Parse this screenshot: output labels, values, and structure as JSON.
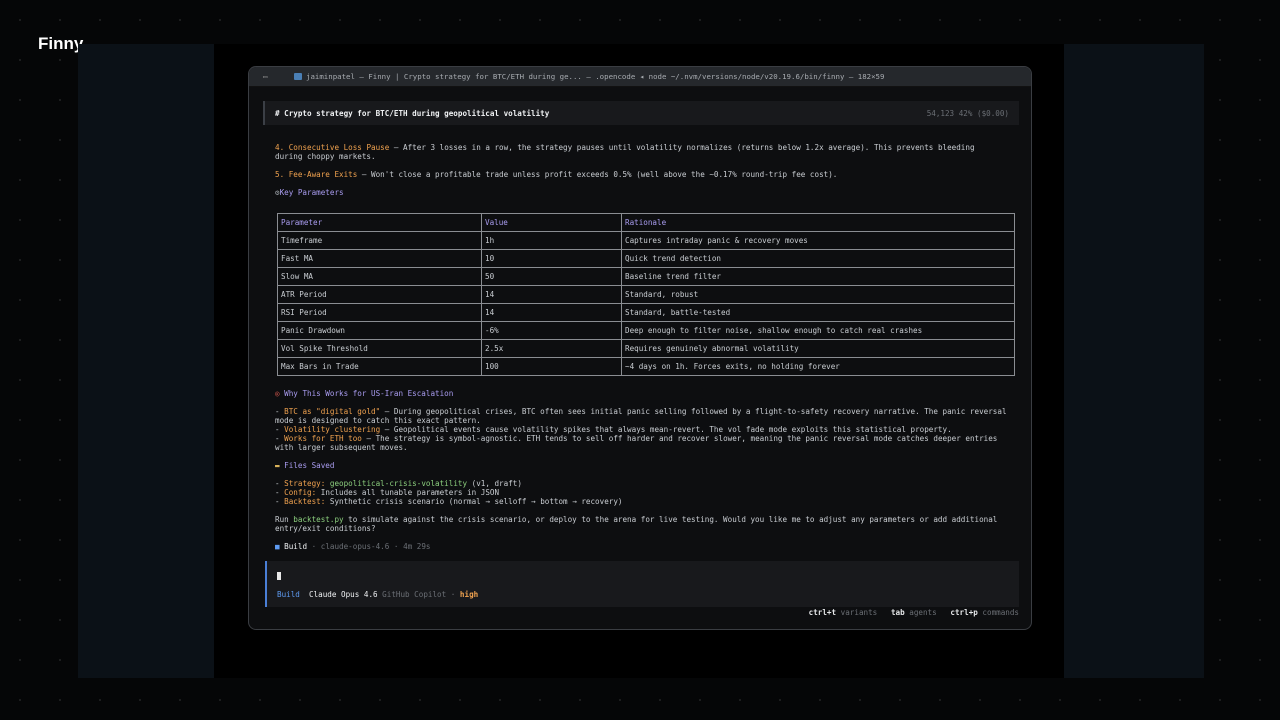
{
  "brand": "Finny",
  "titlebar": "jaiminpatel — Finny | Crypto strategy for BTC/ETH during ge... — .opencode ◂ node ~/.nvm/versions/node/v20.19.6/bin/finny — 182×59",
  "header": {
    "title": "# Crypto strategy for BTC/ETH during geopolitical volatility",
    "stats": "54,123  42% ($0.00)"
  },
  "items": [
    {
      "num": "4.",
      "name": "Consecutive Loss Pause",
      "text": " — After 3 losses in a row, the strategy pauses until volatility normalizes (returns below 1.2x average). This prevents bleeding during choppy markets."
    },
    {
      "num": "5.",
      "name": "Fee-Aware Exits",
      "text": " — Won't close a profitable trade unless profit exceeds 0.5% (well above the ~0.17% round-trip fee cost)."
    }
  ],
  "key_params_heading": "Key Parameters",
  "table": {
    "headers": [
      "Parameter",
      "Value",
      "Rationale"
    ],
    "rows": [
      [
        "Timeframe",
        "1h",
        "Captures intraday panic & recovery moves"
      ],
      [
        "Fast MA",
        "10",
        "Quick trend detection"
      ],
      [
        "Slow MA",
        "50",
        "Baseline trend filter"
      ],
      [
        "ATR Period",
        "14",
        "Standard, robust"
      ],
      [
        "RSI Period",
        "14",
        "Standard, battle-tested"
      ],
      [
        "Panic Drawdown",
        "-6%",
        "Deep enough to filter noise, shallow enough to catch real crashes"
      ],
      [
        "Vol Spike Threshold",
        "2.5x",
        "Requires genuinely abnormal volatility"
      ],
      [
        "Max Bars in Trade",
        "100",
        "~4 days on 1h. Forces exits, no holding forever"
      ]
    ]
  },
  "why_heading": "Why This Works for US-Iran Escalation",
  "why": [
    {
      "name": "BTC as \"digital gold\"",
      "text": " — During geopolitical crises, BTC often sees initial panic selling followed by a flight-to-safety recovery narrative. The panic reversal mode is designed to catch this exact pattern."
    },
    {
      "name": "Volatility clustering",
      "text": " — Geopolitical events cause volatility spikes that always mean-revert. The vol fade mode exploits this statistical property."
    },
    {
      "name": "Works for ETH too",
      "text": " — The strategy is symbol-agnostic. ETH tends to sell off harder and recover slower, meaning the panic reversal mode catches deeper entries with larger subsequent moves."
    }
  ],
  "files_heading": "Files Saved",
  "files": [
    {
      "label": "Strategy:",
      "value": "geopolitical-crisis-volatility",
      "extra": " (v1, draft)"
    },
    {
      "label": "Config:",
      "value": "",
      "extra": " Includes all tunable parameters in JSON"
    },
    {
      "label": "Backtest:",
      "value": "",
      "extra": " Synthetic crisis scenario (normal → selloff → bottom → recovery)"
    }
  ],
  "run": {
    "pre": "Run ",
    "file": "backtest.py",
    "post": " to simulate against the crisis scenario, or deploy to the arena for live testing. Would you like me to adjust any parameters or add additional entry/exit conditions?"
  },
  "build_status": {
    "label": "Build",
    "model": "claude-opus-4.6",
    "time": "4m 29s"
  },
  "input": {
    "mode": "Build",
    "model": "Claude Opus 4.6",
    "provider": "GitHub Copilot",
    "effort": "high"
  },
  "hints": [
    {
      "key": "ctrl+t",
      "label": "variants"
    },
    {
      "key": "tab",
      "label": "agents"
    },
    {
      "key": "ctrl+p",
      "label": "commands"
    }
  ],
  "colors": {
    "accent_orange": "#f0a24f",
    "accent_purple": "#a99cf0",
    "accent_green": "#8ccf7e",
    "accent_blue": "#5e9bf2"
  }
}
